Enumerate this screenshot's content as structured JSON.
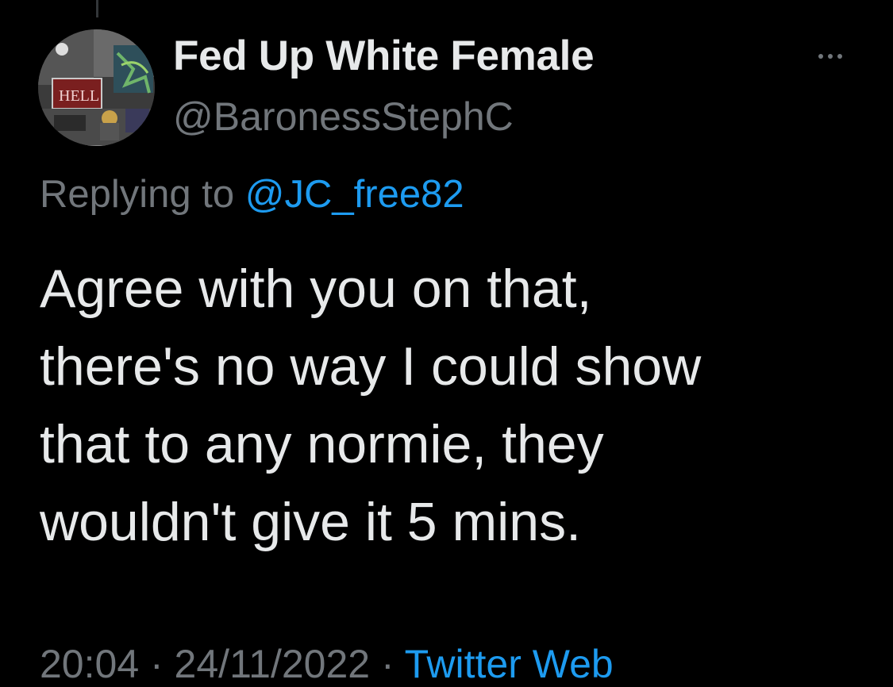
{
  "tweet": {
    "display_name": "Fed Up White Female",
    "handle": "@BaronessStephC",
    "reply_prefix": "Replying to",
    "reply_to": "@JC_free82",
    "text_lines": [
      "Agree with you on that,",
      "there's no way I could show",
      "that to any normie, they",
      "wouldn't give it 5 mins."
    ],
    "timestamp": "20:04 · 24/11/2022 ·",
    "source": "Twitter Web"
  },
  "icons": {
    "more": "more-horizontal-icon",
    "avatar": "profile-avatar-illustration"
  },
  "colors": {
    "background": "#000000",
    "primary_text": "#e7e9ea",
    "secondary_text": "#71767b",
    "accent": "#1d9bf0"
  }
}
